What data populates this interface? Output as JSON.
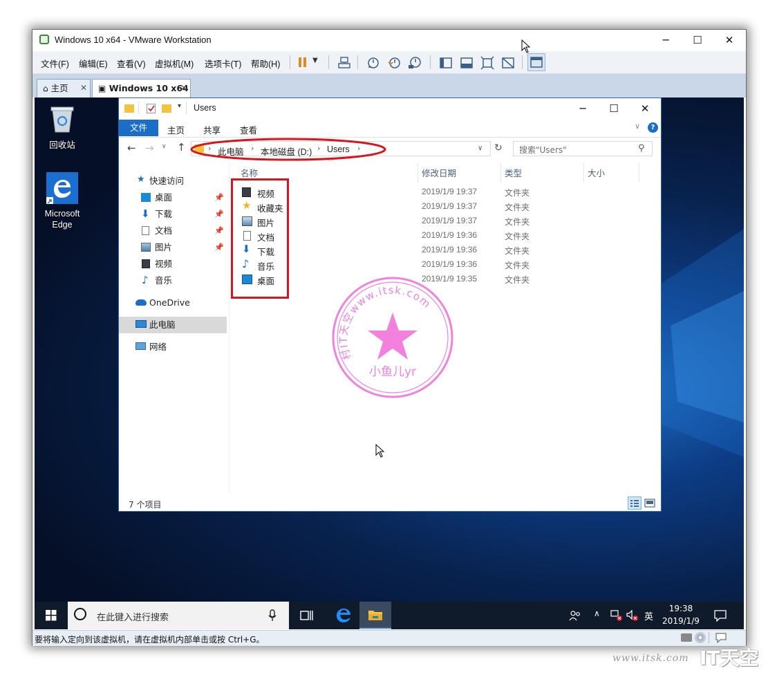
{
  "vmware": {
    "title": "Windows 10 x64 - VMware Workstation",
    "window_buttons": {
      "minimize": "─",
      "maximize": "☐",
      "close": "✕"
    },
    "menus": [
      "文件(F)",
      "编辑(E)",
      "查看(V)",
      "虚拟机(M)",
      "选项卡(T)",
      "帮助(H)"
    ],
    "tabs": [
      {
        "label": "主页",
        "close": "✕"
      },
      {
        "label": "Windows 10 x64",
        "close": "✕"
      }
    ],
    "status_text": "要将输入定向到该虚拟机，请在虚拟机内部单击或按 Ctrl+G。"
  },
  "desktop": {
    "icons": [
      {
        "label": "回收站",
        "icon": "recycle-bin-icon"
      },
      {
        "label": "Microsoft Edge",
        "icon": "edge-icon"
      }
    ]
  },
  "explorer": {
    "title": "Users",
    "window_buttons": {
      "minimize": "─",
      "maximize": "☐",
      "close": "✕"
    },
    "ribbon": {
      "file": "文件",
      "tabs": [
        "主页",
        "共享",
        "查看"
      ]
    },
    "breadcrumb": [
      "此电脑",
      "本地磁盘 (D:)",
      "Users"
    ],
    "search_placeholder": "搜索\"Users\"",
    "nav": {
      "quick_access": "快速访问",
      "quick_items": [
        "桌面",
        "下载",
        "文档",
        "图片",
        "视频",
        "音乐"
      ],
      "onedrive": "OneDrive",
      "this_pc": "此电脑",
      "network": "网络"
    },
    "columns": [
      "名称",
      "修改日期",
      "类型",
      "大小"
    ],
    "files": [
      {
        "name": "视频",
        "date": "2019/1/9 19:37",
        "type": "文件夹",
        "icon": "video-folder-icon"
      },
      {
        "name": "收藏夹",
        "date": "2019/1/9 19:37",
        "type": "文件夹",
        "icon": "star-icon"
      },
      {
        "name": "图片",
        "date": "2019/1/9 19:37",
        "type": "文件夹",
        "icon": "pictures-folder-icon"
      },
      {
        "name": "文档",
        "date": "2019/1/9 19:36",
        "type": "文件夹",
        "icon": "documents-folder-icon"
      },
      {
        "name": "下载",
        "date": "2019/1/9 19:36",
        "type": "文件夹",
        "icon": "download-arrow-icon"
      },
      {
        "name": "音乐",
        "date": "2019/1/9 19:36",
        "type": "文件夹",
        "icon": "music-note-icon"
      },
      {
        "name": "桌面",
        "date": "2019/1/9 19:35",
        "type": "文件夹",
        "icon": "desktop-folder-icon"
      }
    ],
    "status": "7 个项目"
  },
  "stamp": {
    "outer_text": "村IT天空www.itsk.com",
    "inner_text": "小鱼儿yr"
  },
  "taskbar": {
    "search_placeholder": "在此键入进行搜索",
    "ime": "英",
    "time": "19:38",
    "date": "2019/1/9"
  },
  "watermark": {
    "url": "www.itsk.com",
    "brand": "IT天空"
  },
  "colors": {
    "accent": "#1a6ec7",
    "highlight_red": "#d9141c",
    "stamp_pink": "#f06ad8"
  }
}
